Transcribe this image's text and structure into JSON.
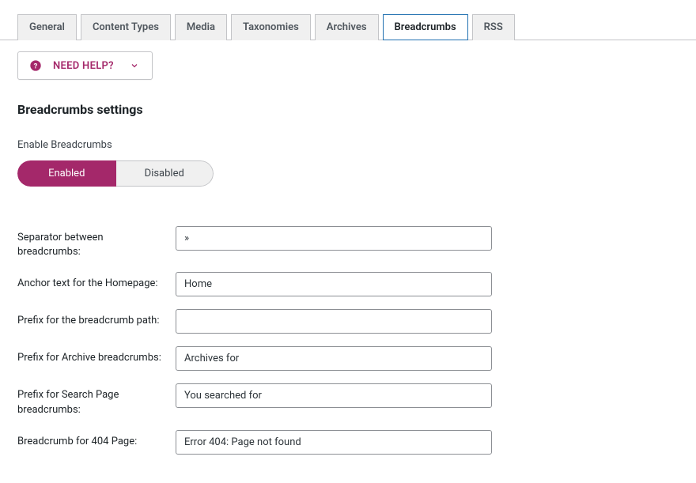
{
  "tabs": [
    {
      "label": "General"
    },
    {
      "label": "Content Types"
    },
    {
      "label": "Media"
    },
    {
      "label": "Taxonomies"
    },
    {
      "label": "Archives"
    },
    {
      "label": "Breadcrumbs"
    },
    {
      "label": "RSS"
    }
  ],
  "help_button": {
    "label": "NEED HELP?"
  },
  "section_title": "Breadcrumbs settings",
  "enable_label": "Enable Breadcrumbs",
  "toggle": {
    "enabled": "Enabled",
    "disabled": "Disabled"
  },
  "fields": {
    "separator": {
      "label": "Separator between breadcrumbs:",
      "value": "»"
    },
    "anchor": {
      "label": "Anchor text for the Homepage:",
      "value": "Home"
    },
    "prefix_path": {
      "label": "Prefix for the breadcrumb path:",
      "value": ""
    },
    "prefix_archive": {
      "label": "Prefix for Archive breadcrumbs:",
      "value": "Archives for"
    },
    "prefix_search": {
      "label": "Prefix for Search Page breadcrumbs:",
      "value": "You searched for"
    },
    "prefix_404": {
      "label": "Breadcrumb for 404 Page:",
      "value": "Error 404: Page not found"
    }
  }
}
